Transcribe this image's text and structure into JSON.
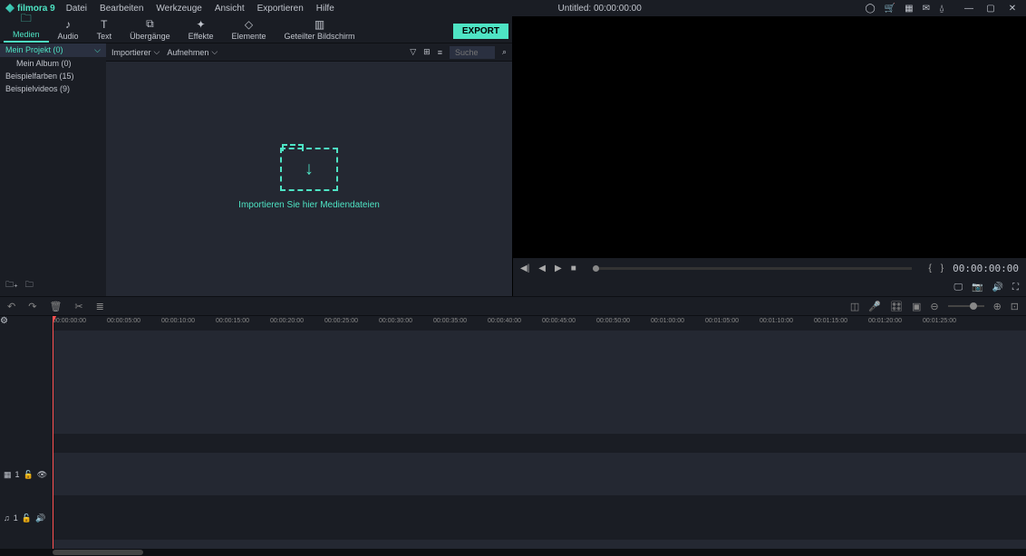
{
  "app": {
    "name": "filmora 9",
    "title_prefix": "Untitled:",
    "title_time": "00:00:00:00"
  },
  "menu": [
    "Datei",
    "Bearbeiten",
    "Werkzeuge",
    "Ansicht",
    "Exportieren",
    "Hilfe"
  ],
  "tabs": [
    {
      "label": "Medien",
      "icon": "folder"
    },
    {
      "label": "Audio",
      "icon": "music"
    },
    {
      "label": "Text",
      "icon": "text"
    },
    {
      "label": "Übergänge",
      "icon": "transition"
    },
    {
      "label": "Effekte",
      "icon": "effects"
    },
    {
      "label": "Elemente",
      "icon": "elements"
    },
    {
      "label": "Geteilter Bildschirm",
      "icon": "split"
    }
  ],
  "export_label": "EXPORT",
  "sidebar": {
    "items": [
      {
        "label": "Mein Projekt (0)",
        "selected": true
      },
      {
        "label": "Mein Album (0)",
        "sub": true
      },
      {
        "label": "Beispielfarben (15)"
      },
      {
        "label": "Beispielvideos (9)"
      }
    ]
  },
  "media_toolbar": {
    "importer": "Importierer",
    "record": "Aufnehmen",
    "search_placeholder": "Suche"
  },
  "drop_text": "Importieren Sie hier Mediendateien",
  "preview": {
    "time": "00:00:00:00"
  },
  "ruler_marks": [
    "00:00:00:00",
    "00:00:05:00",
    "00:00:10:00",
    "00:00:15:00",
    "00:00:20:00",
    "00:00:25:00",
    "00:00:30:00",
    "00:00:35:00",
    "00:00:40:00",
    "00:00:45:00",
    "00:00:50:00",
    "00:01:00:00",
    "00:01:05:00",
    "00:01:10:00",
    "00:01:15:00",
    "00:01:20:00",
    "00:01:25:00"
  ],
  "tracks": {
    "video_label": "1",
    "audio_label": "1"
  }
}
